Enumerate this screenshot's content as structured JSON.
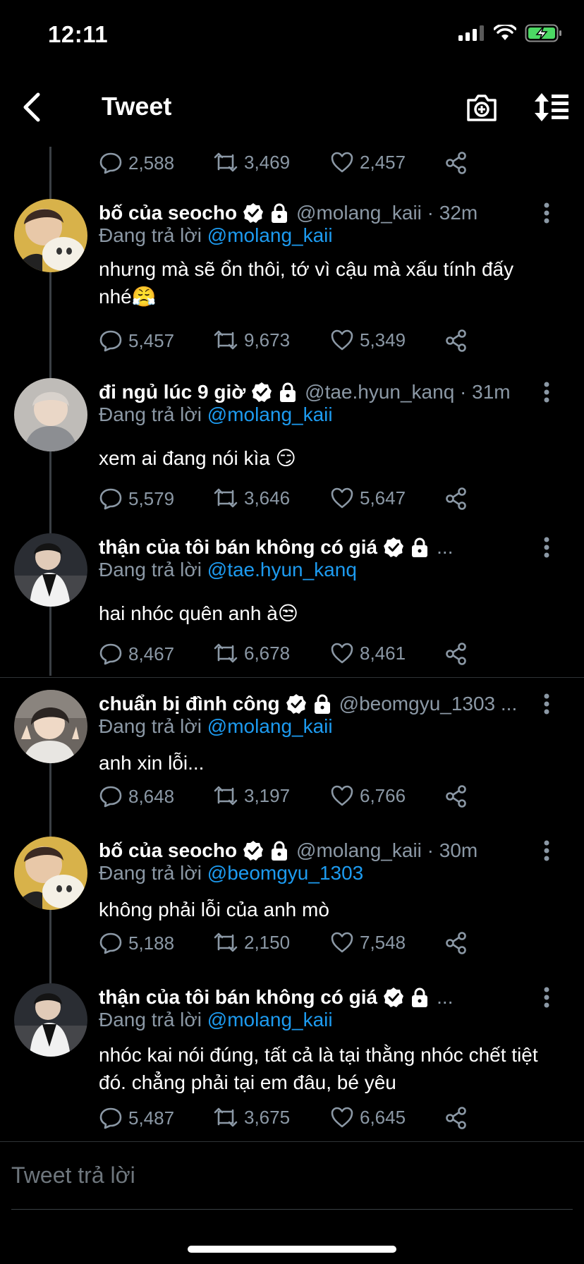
{
  "status_bar": {
    "time": "12:11",
    "battery_color": "#4cd964"
  },
  "nav": {
    "title": "Tweet"
  },
  "reply_label": "Đang trả lời",
  "top_actions": {
    "replies": "2,588",
    "retweets": "3,469",
    "likes": "2,457"
  },
  "tweets": [
    {
      "name": "bố của seocho",
      "handle": "@molang_kaii · 32m",
      "reply_to": "@molang_kaii",
      "text": "nhưng mà sẽ ổn thôi, tớ vì cậu mà xấu tính đấy nhé😤",
      "replies": "5,457",
      "retweets": "9,673",
      "likes": "5,349"
    },
    {
      "name": "đi ngủ lúc 9 giờ",
      "handle": "@tae.hyun_kanq · 31m",
      "reply_to": "@molang_kaii",
      "text": "xem ai đang nói kìa 😏",
      "replies": "5,579",
      "retweets": "3,646",
      "likes": "5,647"
    },
    {
      "name": "thận của tôi bán không có giá",
      "handle": "...",
      "reply_to": "@tae.hyun_kanq",
      "text": "hai nhóc quên anh à😒",
      "replies": "8,467",
      "retweets": "6,678",
      "likes": "8,461"
    },
    {
      "name": "chuẩn bị đình công",
      "handle": "@beomgyu_1303 ...",
      "reply_to": "@molang_kaii",
      "text": "anh xin lỗi...",
      "replies": "8,648",
      "retweets": "3,197",
      "likes": "6,766"
    },
    {
      "name": "bố của seocho",
      "handle": "@molang_kaii · 30m",
      "reply_to": "@beomgyu_1303",
      "text": "không phải lỗi của anh mò",
      "replies": "5,188",
      "retweets": "2,150",
      "likes": "7,548"
    },
    {
      "name": "thận của tôi bán không có giá",
      "handle": "...",
      "reply_to": "@molang_kaii",
      "text": "nhóc kai nói đúng, tất cả là tại thằng nhóc chết tiệt đó. chẳng phải tại em đâu, bé yêu",
      "replies": "5,487",
      "retweets": "3,675",
      "likes": "6,645"
    }
  ],
  "composer": {
    "placeholder": "Tweet trả lời"
  }
}
